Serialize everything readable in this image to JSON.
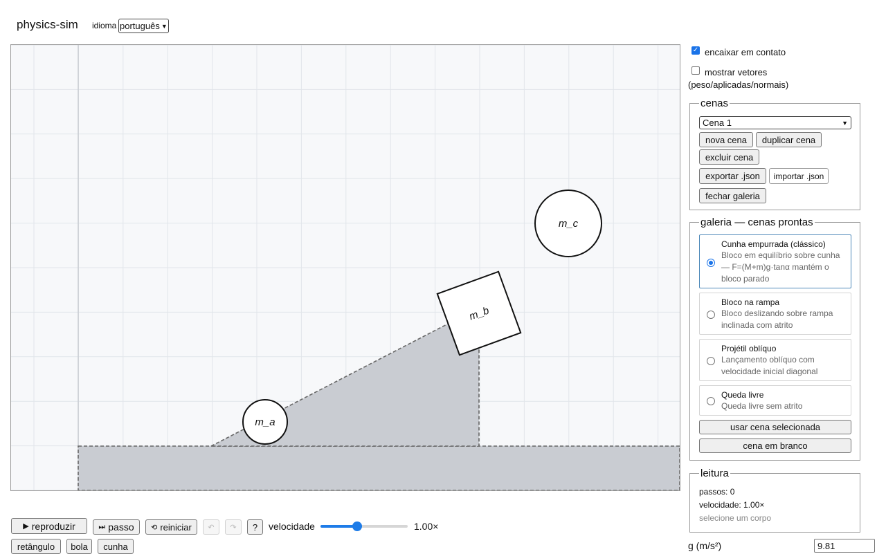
{
  "app": {
    "title": "physics-sim",
    "language_label": "idioma",
    "language_value": "português"
  },
  "canvas": {
    "bodies": [
      {
        "id": "ball-a",
        "label": "m_a",
        "kind": "bola"
      },
      {
        "id": "box-b",
        "label": "m_b",
        "kind": "retângulo"
      },
      {
        "id": "ball-c",
        "label": "m_c",
        "kind": "bola"
      }
    ]
  },
  "controls": {
    "play_label": "reproduzir",
    "step_label": "passo",
    "reset_label": "reiniciar",
    "undo_icon": "↶",
    "redo_icon": "↷",
    "help_label": "?",
    "speed_label": "velocidade",
    "speed_value": "1.00×",
    "speed_fraction": 0.42
  },
  "add_tools": {
    "rectangle_label": "retângulo",
    "ball_label": "bola",
    "wedge_label": "cunha"
  },
  "options": {
    "snap_label": "encaixar em contato",
    "snap_checked": true,
    "vectors_label": "mostrar vetores",
    "vectors_sub": "(peso/aplicadas/normais)",
    "vectors_checked": false
  },
  "scenes": {
    "legend": "cenas",
    "selected": "Cena 1",
    "new_label": "nova cena",
    "duplicate_label": "duplicar cena",
    "delete_label": "excluir cena",
    "export_label": "exportar .json",
    "import_label": "importar .json",
    "close_gallery_label": "fechar galeria"
  },
  "gallery": {
    "legend": "galeria — cenas prontas",
    "items": [
      {
        "title": "Cunha empurrada (clássico)",
        "description": "Bloco em equilíbrio sobre cunha — F=(M+m)g·tanα mantém o bloco parado",
        "selected": true
      },
      {
        "title": "Bloco na rampa",
        "description": "Bloco deslizando sobre rampa inclinada com atrito",
        "selected": false
      },
      {
        "title": "Projétil oblíquo",
        "description": "Lançamento oblíquo com velocidade inicial diagonal",
        "selected": false
      },
      {
        "title": "Queda livre",
        "description": "Queda livre sem atrito",
        "selected": false
      }
    ],
    "use_label": "usar cena selecionada",
    "blank_label": "cena em branco"
  },
  "readout": {
    "legend": "leitura",
    "steps": "passos: 0",
    "speed": "velocidade: 1.00×",
    "hint": "selecione um corpo"
  },
  "gravity": {
    "label": "g (m/s²)",
    "value": "9.81"
  }
}
